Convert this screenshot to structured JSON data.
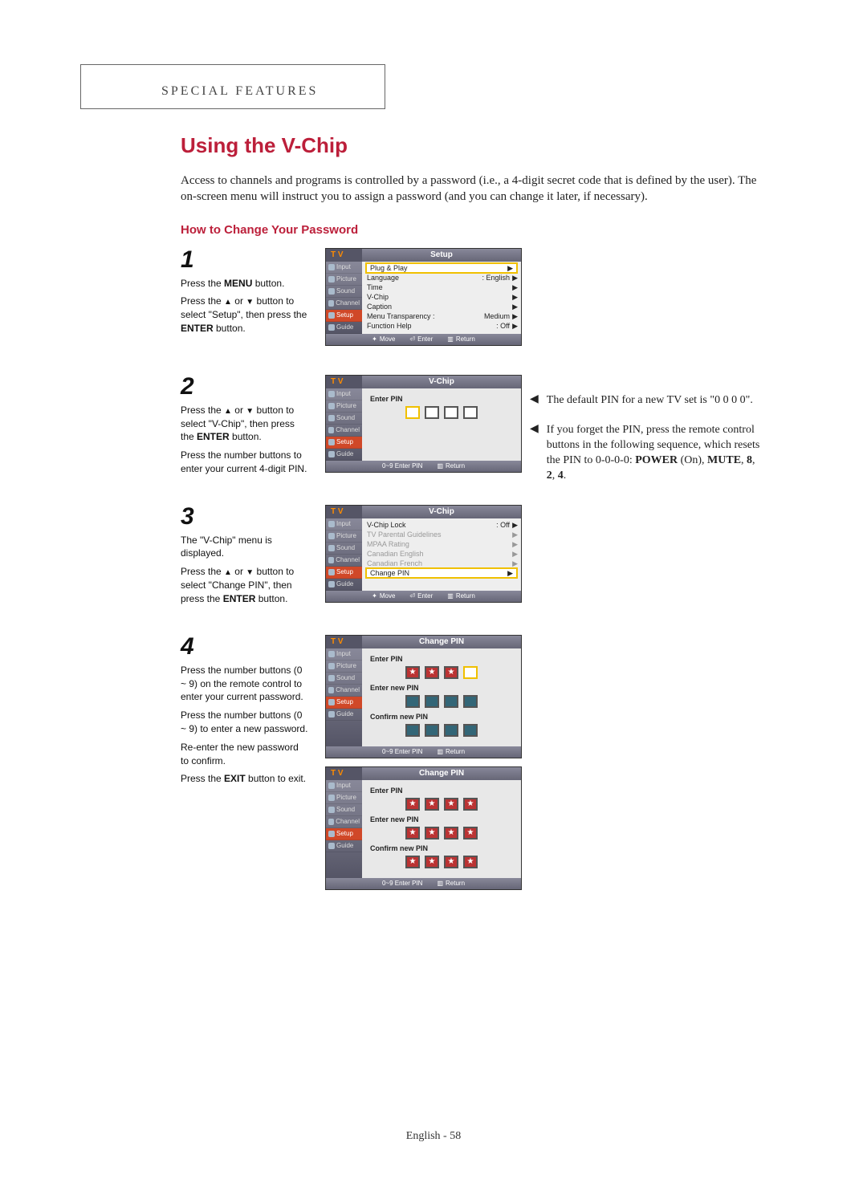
{
  "header": {
    "section": "SPECIAL FEATURES"
  },
  "title": "Using the V-Chip",
  "intro": "Access to channels and programs is controlled by a password (i.e., a 4-digit secret code that is defined by the user). The on-screen menu will instruct you to assign a password (and you can change it later, if necessary).",
  "subhead": "How to Change Your Password",
  "steps": {
    "s1": {
      "num": "1",
      "p1a": "Press the ",
      "p1b": "MENU",
      "p1c": " button.",
      "p2a": "Press the ",
      "p2up": "▲",
      "p2mid": " or ",
      "p2dn": "▼",
      "p2b": " button to select \"Setup\", then press the ",
      "p2c": "ENTER",
      "p2d": " button."
    },
    "s2": {
      "num": "2",
      "p1a": "Press the ",
      "p1up": "▲",
      "p1mid": " or ",
      "p1dn": "▼",
      "p1b": " button to select \"V-Chip\", then press the ",
      "p1c": "ENTER",
      "p1d": " button.",
      "p2": "Press the number buttons to enter your current 4-digit PIN."
    },
    "s3": {
      "num": "3",
      "p1": "The \"V-Chip\" menu is displayed.",
      "p2a": "Press the ",
      "p2up": "▲",
      "p2mid": " or ",
      "p2dn": "▼",
      "p2b": " button to select \"Change PIN\", then press the ",
      "p2c": "ENTER",
      "p2d": " button."
    },
    "s4": {
      "num": "4",
      "p1": "Press the number buttons (0 ~ 9) on the remote control to enter your current password.",
      "p2": "Press the number buttons (0 ~ 9) to enter a new password.",
      "p3": "Re-enter the new password to confirm.",
      "p4a": "Press the ",
      "p4b": "EXIT",
      "p4c": " button to exit."
    }
  },
  "osd_side": {
    "input": "Input",
    "picture": "Picture",
    "sound": "Sound",
    "channel": "Channel",
    "setup": "Setup",
    "guide": "Guide"
  },
  "osd1": {
    "tv": "T V",
    "title": "Setup",
    "items": {
      "plug": "Plug & Play",
      "language_l": "Language",
      "language_v": ": English",
      "time": "Time",
      "vchip": "V-Chip",
      "caption": "Caption",
      "transp_l": "Menu Transparency :",
      "transp_v": "Medium",
      "help_l": "Function Help",
      "help_v": ": Off"
    },
    "foot": {
      "move": "Move",
      "enter": "Enter",
      "return": "Return"
    }
  },
  "osd2": {
    "tv": "T V",
    "title": "V-Chip",
    "enter_pin": "Enter PIN",
    "foot": {
      "enter": "0~9 Enter PIN",
      "return": "Return"
    }
  },
  "osd3": {
    "tv": "T V",
    "title": "V-Chip",
    "items": {
      "lock_l": "V-Chip Lock",
      "lock_v": ": Off",
      "parental": "TV Parental Guidelines",
      "mpaa": "MPAA Rating",
      "caneng": "Canadian English",
      "canfr": "Canadian French",
      "change": "Change PIN"
    },
    "foot": {
      "move": "Move",
      "enter": "Enter",
      "return": "Return"
    }
  },
  "osd4a": {
    "tv": "T V",
    "title": "Change PIN",
    "enter_pin": "Enter PIN",
    "enter_new": "Enter new PIN",
    "confirm": "Confirm new PIN",
    "foot": {
      "enter": "0~9 Enter PIN",
      "return": "Return"
    }
  },
  "osd4b": {
    "tv": "T V",
    "title": "Change PIN",
    "enter_pin": "Enter PIN",
    "enter_new": "Enter new PIN",
    "confirm": "Confirm new PIN",
    "foot": {
      "enter": "0~9 Enter PIN",
      "return": "Return"
    }
  },
  "notes": {
    "n1": "The default PIN for a new TV set is \"0 0 0 0\".",
    "n2a": "If you forget the PIN, press the remote control buttons in the following sequence, which resets the PIN to 0-0-0-0: ",
    "n2b": "POWER",
    "n2c": " (On), ",
    "n2d": "MUTE",
    "n2e": ", ",
    "n2f": "8",
    "n2g": ", ",
    "n2h": "2",
    "n2i": ", ",
    "n2j": "4",
    "n2k": "."
  },
  "footer": "English - 58"
}
